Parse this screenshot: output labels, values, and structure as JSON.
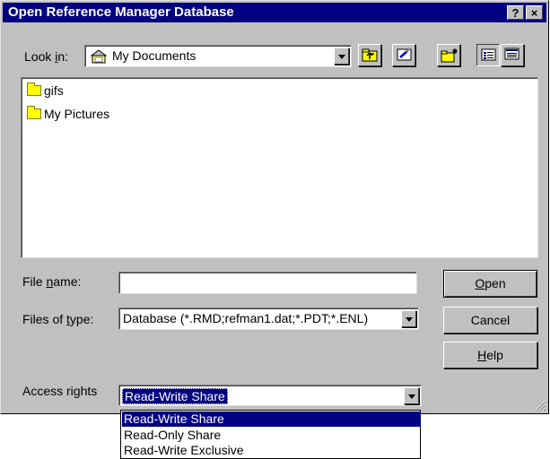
{
  "window": {
    "title": "Open Reference Manager Database",
    "help_button": "?",
    "close_button": "×"
  },
  "look_in": {
    "label_pre": "Look ",
    "label_ul": "i",
    "label_post": "n:",
    "value": "My Documents"
  },
  "toolbar": {
    "icons": [
      "up-one-level-icon",
      "desktop-icon",
      "new-folder-icon",
      "list-view-icon",
      "details-view-icon"
    ]
  },
  "files": [
    {
      "name": "gifs",
      "icon": "folder-icon"
    },
    {
      "name": "My Pictures",
      "icon": "folder-icon"
    }
  ],
  "file_name": {
    "label_pre": "File ",
    "label_ul": "n",
    "label_post": "ame:",
    "value": ""
  },
  "files_of_type": {
    "label_pre": "Files of ",
    "label_ul": "t",
    "label_post": "ype:",
    "value": "Database (*.RMD;refman1.dat;*.PDT;*.ENL)"
  },
  "access_rights": {
    "label": "Access rights",
    "value": "Read-Write Share",
    "options": [
      "Read-Write Share",
      "Read-Only Share",
      "Read-Write Exclusive"
    ]
  },
  "buttons": {
    "open_ul": "O",
    "open_rest": "pen",
    "cancel": "Cancel",
    "help_ul": "H",
    "help_rest": "elp"
  },
  "colors": {
    "titlebar": "#000080",
    "face": "#c0c0c0",
    "selection": "#000080"
  }
}
